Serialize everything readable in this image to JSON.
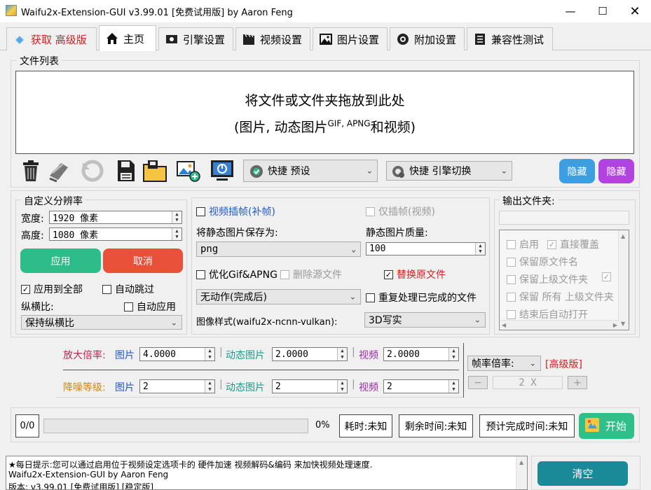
{
  "window": {
    "title": "Waifu2x-Extension-GUI v3.99.01 [免费试用版] by Aaron Feng"
  },
  "tabs": [
    {
      "label": "获取 高级版",
      "icon": "diamond-icon"
    },
    {
      "label": "主页",
      "icon": "home-icon"
    },
    {
      "label": "引擎设置",
      "icon": "engine-icon"
    },
    {
      "label": "视频设置",
      "icon": "clapperboard-icon"
    },
    {
      "label": "图片设置",
      "icon": "picture-icon"
    },
    {
      "label": "附加设置",
      "icon": "gear-icon"
    },
    {
      "label": "兼容性测试",
      "icon": "checklist-icon"
    }
  ],
  "file_list": {
    "title": "文件列表",
    "drop_line1": "将文件或文件夹拖放到此处",
    "drop_line2_pre": "(图片, 动态图片",
    "drop_line2_sup": "GIF, APNG",
    "drop_line2_post": "和视频)"
  },
  "toolbar": {
    "preset_label": "快捷  预设",
    "engine_switch_label": "快捷  引擎切换",
    "hide_btn1": "隐藏",
    "hide_btn2": "隐藏"
  },
  "resolution": {
    "title": "自定义分辨率",
    "width_label": "宽度:",
    "width_value": "1920 像素",
    "height_label": "高度:",
    "height_value": "1080 像素",
    "apply": "应用",
    "cancel": "取消",
    "apply_all": "应用到全部",
    "auto_skip": "自动跳过",
    "aspect_label": "纵横比:",
    "auto_apply": "自动应用",
    "aspect_value": "保持纵横比"
  },
  "middle": {
    "video_interp": "视频插帧(补帧)",
    "only_interp": "仅插帧(视频)",
    "save_as_label": "将静态图片保存为:",
    "save_as_value": "png",
    "quality_label": "静态图片质量:",
    "quality_value": "100",
    "optimize": "优化Gif&APNG",
    "delete_src": "删除源文件",
    "replace_src": "替换原文件",
    "after_action": "无动作(完成后)",
    "reprocess": "重复处理已完成的文件",
    "style_label": "图像样式(waifu2x-ncnn-vulkan):",
    "style_value": "3D写实"
  },
  "output": {
    "title": "输出文件夹:",
    "enable": "启用",
    "overwrite": "直接覆盖",
    "keep_name": "保留原文件名",
    "keep_parent": "保留上级文件夹",
    "keep_all": "保留 所有 上级文件夹",
    "open_after": "结束后自动打开"
  },
  "scale": {
    "scale_label": "放大倍率:",
    "img_label": "图片",
    "img_value": "4.0000",
    "gif_label": "动态图片",
    "gif_value": "2.0000",
    "video_label": "视频",
    "video_value": "2.0000",
    "denoise_label": "降噪等级:",
    "d_img_value": "2",
    "d_gif_value": "2",
    "d_video_value": "2",
    "framerate_label": "帧率倍率:",
    "premium": "[高级版]",
    "minus": "−",
    "rate_value": "2 X",
    "plus": "+"
  },
  "progress": {
    "count": "0/0",
    "percent_value": 0,
    "percent": "0%",
    "elapsed": "耗时:未知",
    "remaining": "剩余时间:未知",
    "eta": "预计完成时间:未知",
    "start": "开始"
  },
  "log": {
    "line1": "★每日提示:您可以通过启用位于视频设定选项卡的 硬件加速 视频解码&编码 来加快视频处理速度.",
    "line2": "Waifu2x-Extension-GUI by Aaron Feng",
    "line3": "版本: v3.99.01 [免费试用版] [稳定版]",
    "clear": "清空"
  },
  "colors": {
    "green": "#2dbd8a",
    "red": "#e8503a",
    "blue": "#3d9ee0",
    "purple": "#b144e0",
    "teal": "#1a8a99",
    "start_green": "#2fc08a",
    "scale_red": "#c4254f",
    "denoise_orange": "#d4860c",
    "link_blue": "#2058c8",
    "gif_teal": "#1a9a8a",
    "video_purple": "#9a2aa8"
  }
}
